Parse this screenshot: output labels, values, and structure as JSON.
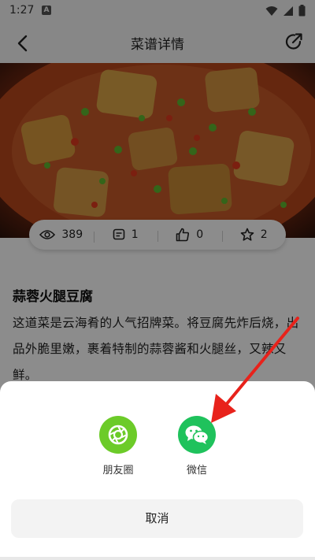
{
  "status_bar": {
    "time": "1:27",
    "notification_badge": "A"
  },
  "header": {
    "title": "菜谱详情"
  },
  "stats": {
    "views": "389",
    "comments": "1",
    "likes": "0",
    "favorites": "2"
  },
  "recipe": {
    "title": "蒜蓉火腿豆腐",
    "description": "这道菜是云海肴的人气招牌菜。将豆腐先炸后烧，出品外脆里嫩，裹着特制的蒜蓉酱和火腿丝，又辣又鲜。"
  },
  "share_sheet": {
    "moments_label": "朋友圈",
    "wechat_label": "微信",
    "cancel_label": "取消"
  },
  "colors": {
    "moments_green": "#6ccb29",
    "wechat_green": "#1fc25c",
    "annotation_red": "#e8221b"
  }
}
